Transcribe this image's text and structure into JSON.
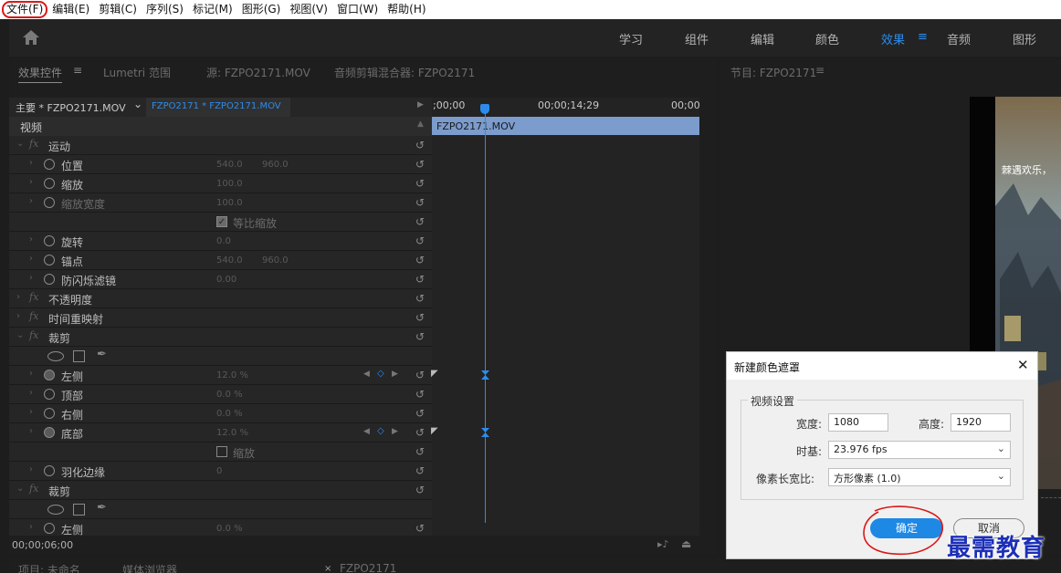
{
  "menubar": {
    "items": [
      "文件(F)",
      "编辑(E)",
      "剪辑(C)",
      "序列(S)",
      "标记(M)",
      "图形(G)",
      "视图(V)",
      "窗口(W)",
      "帮助(H)"
    ]
  },
  "workspaces": {
    "items": [
      "学习",
      "组件",
      "编辑",
      "颜色",
      "效果",
      "音频",
      "图形"
    ],
    "active": "效果"
  },
  "left_panel": {
    "tabs": [
      "效果控件",
      "Lumetri 范围",
      "源: FZPO2171.MOV",
      "音频剪辑混合器: FZPO2171"
    ]
  },
  "program_panel": {
    "tab": "节目: FZPO2171",
    "caption": "棘遇欢乐，"
  },
  "effect_controls": {
    "master_label": "主要 * FZPO2171.MOV",
    "sequence_label": "FZPO2171 * FZPO2171.MOV",
    "section_label": "视频",
    "clip_name": "FZPO2171.MOV",
    "time_start": ";00;00",
    "time_mid": "00;00;14;29",
    "time_end": "00;00",
    "current_time": "00;00;06;00",
    "rows": [
      {
        "kind": "group",
        "label": "运动"
      },
      {
        "kind": "param",
        "label": "位置",
        "v1": "540.0",
        "v2": "960.0"
      },
      {
        "kind": "param",
        "label": "缩放",
        "v1": "100.0",
        "v2": ""
      },
      {
        "kind": "param",
        "label": "缩放宽度",
        "v1": "100.0",
        "v2": "",
        "dim": true
      },
      {
        "kind": "check",
        "label": "等比缩放",
        "checked": true
      },
      {
        "kind": "param",
        "label": "旋转",
        "v1": "0.0",
        "v2": ""
      },
      {
        "kind": "param",
        "label": "锚点",
        "v1": "540.0",
        "v2": "960.0"
      },
      {
        "kind": "param",
        "label": "防闪烁滤镜",
        "v1": "0.00",
        "v2": ""
      },
      {
        "kind": "group",
        "label": "不透明度"
      },
      {
        "kind": "group",
        "label": "时间重映射"
      },
      {
        "kind": "group",
        "label": "裁剪"
      },
      {
        "kind": "shapes",
        "label": ""
      },
      {
        "kind": "param",
        "label": "左侧",
        "v1": "12.0 %",
        "v2": "",
        "keyed": true
      },
      {
        "kind": "param",
        "label": "顶部",
        "v1": "0.0 %",
        "v2": ""
      },
      {
        "kind": "param",
        "label": "右侧",
        "v1": "0.0 %",
        "v2": ""
      },
      {
        "kind": "param",
        "label": "底部",
        "v1": "12.0 %",
        "v2": "",
        "keyed": true
      },
      {
        "kind": "check",
        "label": "缩放",
        "checked": false
      },
      {
        "kind": "param",
        "label": "羽化边缘",
        "v1": "0",
        "v2": ""
      },
      {
        "kind": "group",
        "label": "裁剪"
      },
      {
        "kind": "shapes",
        "label": ""
      },
      {
        "kind": "param",
        "label": "左侧",
        "v1": "0.0 %",
        "v2": ""
      }
    ]
  },
  "bottom_panels": {
    "project_tab": "项目: 未命名",
    "media_tab": "媒体浏览器",
    "sequence_tab": "FZPO2171"
  },
  "dialog": {
    "title": "新建颜色遮罩",
    "group_title": "视频设置",
    "width_label": "宽度:",
    "width_value": "1080",
    "height_label": "高度:",
    "height_value": "1920",
    "timebase_label": "时基:",
    "timebase_value": "23.976 fps",
    "pixel_aspect_label": "像素长宽比:",
    "pixel_aspect_value": "方形像素 (1.0)",
    "ok_label": "确定",
    "cancel_label": "取消"
  },
  "watermark": "最需教育",
  "colors": {
    "accent": "#2d8ceb",
    "clip": "#7b9ccc",
    "annotation": "#d81a1a",
    "ok_button": "#1e88e5"
  }
}
